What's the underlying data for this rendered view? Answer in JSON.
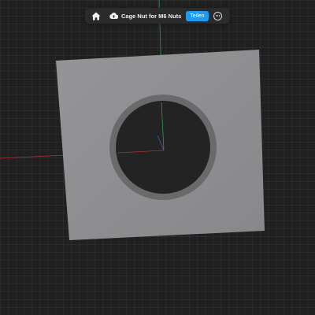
{
  "toolbar": {
    "home_icon": "home-icon",
    "cloud_icon": "cloud-sync-icon",
    "document_title": "Cage Nut for M6 Nuts",
    "share_label": "Teilen",
    "more_icon": "more-options-icon"
  },
  "colors": {
    "share_button": "#1e9bf0",
    "plate": "#8f8f92",
    "hole": "#232323",
    "axis_x": "#b03232",
    "axis_y": "#2f9a4c",
    "axis_z": "#3a5fc0"
  }
}
